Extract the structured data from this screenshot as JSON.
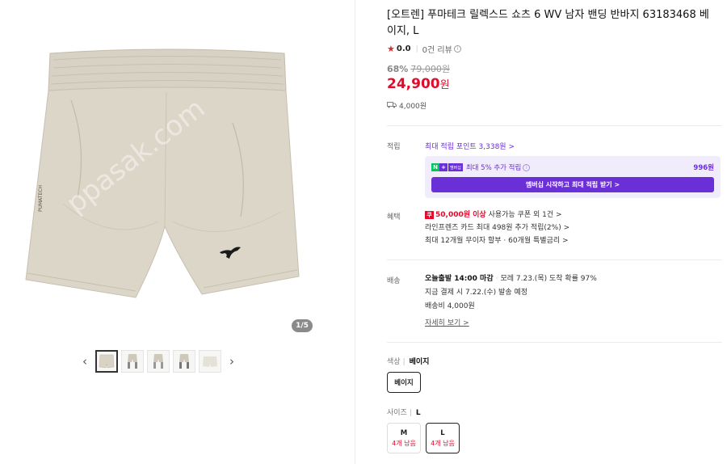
{
  "gallery": {
    "counter": "1/5",
    "thumbs": [
      "thumb-1",
      "thumb-2",
      "thumb-3",
      "thumb-4",
      "thumb-5"
    ],
    "logo_text": "PUMATECH",
    "watermark": "ppasak.com"
  },
  "product": {
    "title": "[오트렌] 푸마테크 릴렉스드 쇼츠 6 WV 남자 밴딩 반바지 63183468 베이지, L",
    "rating": "0.0",
    "review_count": "0건 리뷰",
    "discount": "68%",
    "original_price": "79,000원",
    "sale_price": "24,900",
    "currency": "원",
    "shipping_fee": "4,000원"
  },
  "points": {
    "label": "적립",
    "max_points": "최대 적립 포인트 3,338원 >",
    "membership_text": "최대 5% 추가 적립",
    "membership_points": "996원",
    "membership_btn": "멤버십 시작하고 최대 적립 받기 >",
    "npay_n": "N",
    "npay_plus": "+",
    "npay_m": "멤버십"
  },
  "benefits": {
    "label": "혜택",
    "coupon_icon": "쿠",
    "coupon_threshold": "50,000원 이상",
    "coupon_text": " 사용가능 쿠폰 외 1건 >",
    "card_text": "라인프렌즈 카드 최대 498원 추가 적립(2%) >",
    "installment_text": "최대 12개월 무이자 할부 · 60개월 특별금리 >"
  },
  "delivery": {
    "label": "배송",
    "today_ship": "오늘출발 14:00 마감",
    "arrival": "모레 7.23.(목) 도착 확률 97%",
    "payment_note": "지금 결제 시 7.22.(수) 발송 예정",
    "fee": "배송비 4,000원",
    "detail_link": "자세히 보기 >"
  },
  "options": {
    "color_label": "색상",
    "color_selected": "베이지",
    "color_chip": "베이지",
    "size_label": "사이즈",
    "size_selected": "L",
    "sizes": [
      {
        "name": "M",
        "stock": "4개 남음"
      },
      {
        "name": "L",
        "stock": "4개 남음"
      }
    ]
  },
  "colors": {
    "accent_purple": "#6a2fd6",
    "price_red": "#e30a2b",
    "garment_beige": "#d9d3c6"
  }
}
